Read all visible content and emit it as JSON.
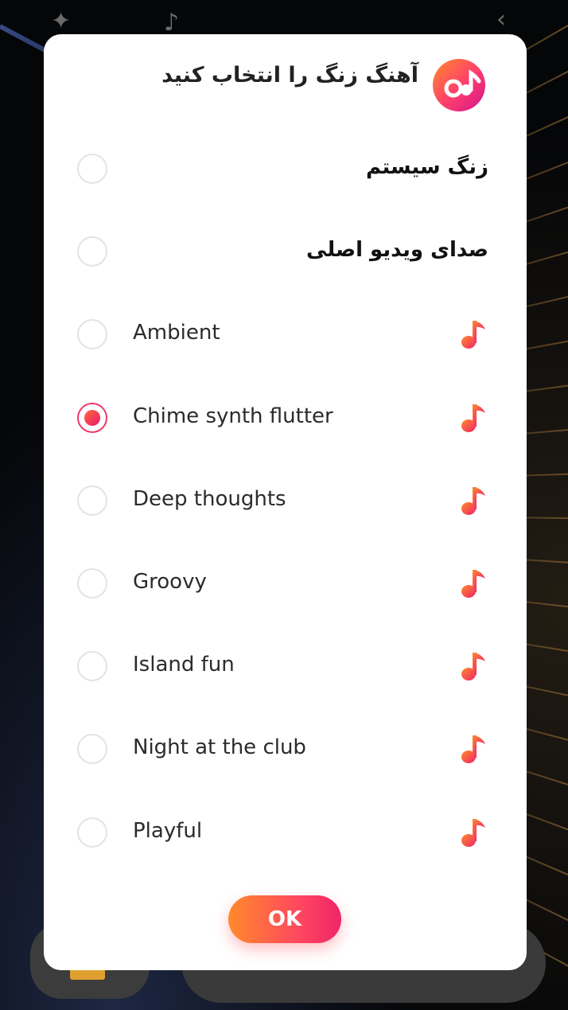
{
  "dialog": {
    "title": "آهنگ زنگ را انتخاب کنید",
    "logo_icon": "music-app-logo",
    "accent_gradient": [
      "#ff8a2a",
      "#f0246a"
    ],
    "options": [
      {
        "label": "زنگ سیستم",
        "rtl": true,
        "has_note_icon": false,
        "selected": false
      },
      {
        "label": "صدای ویدیو اصلی",
        "rtl": true,
        "has_note_icon": false,
        "selected": false
      },
      {
        "label": "Ambient",
        "rtl": false,
        "has_note_icon": true,
        "selected": false
      },
      {
        "label": "Chime synth flutter",
        "rtl": false,
        "has_note_icon": true,
        "selected": true
      },
      {
        "label": "Deep thoughts",
        "rtl": false,
        "has_note_icon": true,
        "selected": false
      },
      {
        "label": "Groovy",
        "rtl": false,
        "has_note_icon": true,
        "selected": false
      },
      {
        "label": "Island fun",
        "rtl": false,
        "has_note_icon": true,
        "selected": false
      },
      {
        "label": "Night at the club",
        "rtl": false,
        "has_note_icon": true,
        "selected": false
      },
      {
        "label": "Playful",
        "rtl": false,
        "has_note_icon": true,
        "selected": false
      }
    ],
    "ok_label": "OK"
  },
  "note_icon_name": "music-note-icon"
}
